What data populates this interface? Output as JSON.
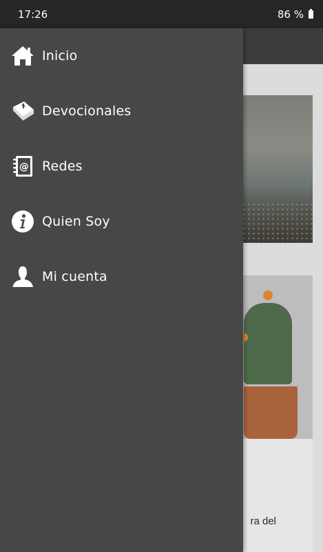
{
  "status_bar": {
    "time": "17:26",
    "battery": "86 %"
  },
  "drawer": {
    "items": [
      {
        "label": "Inicio",
        "icon": "home-icon"
      },
      {
        "label": "Devocionales",
        "icon": "bible-icon"
      },
      {
        "label": "Redes",
        "icon": "address-book-icon"
      },
      {
        "label": "Quien Soy",
        "icon": "info-icon"
      },
      {
        "label": "Mi cuenta",
        "icon": "user-icon"
      }
    ]
  },
  "background": {
    "card_snippet": "ra del"
  }
}
